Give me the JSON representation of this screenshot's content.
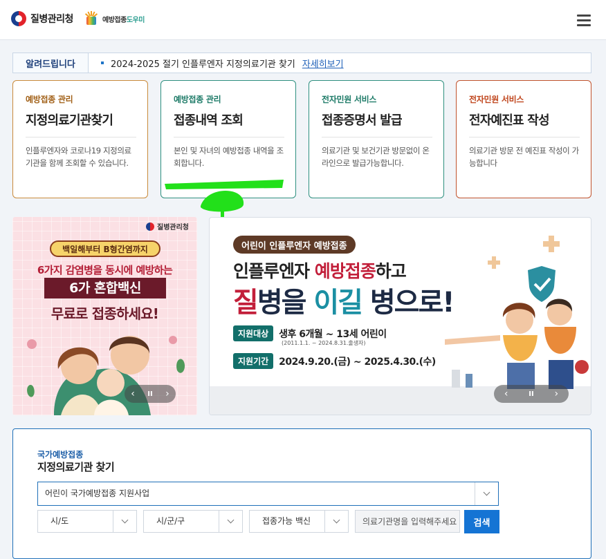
{
  "header": {
    "logo_text": "질병관리청",
    "helper_logo_prefix": "예방접종",
    "helper_logo_suffix": "도우미"
  },
  "notice": {
    "label": "알려드립니다",
    "text": "2024-2025 절기 인플루엔자 지정의료기관 찾기",
    "link": "자세히보기"
  },
  "cards": [
    {
      "category": "예방접종 관리",
      "title": "지정의료기관찾기",
      "desc": "인플루엔자와 코로나19 지정의료기관을 함께 조회할 수 있습니다."
    },
    {
      "category": "예방접종 관리",
      "title": "접종내역 조회",
      "desc": "본인 및 자녀의 예방접종 내역을 조회합니다."
    },
    {
      "category": "전자민원 서비스",
      "title": "접종증명서 발급",
      "desc": "의료기관 및 보건기관 방문없이 온라인으로 발급가능합니다."
    },
    {
      "category": "전자민원 서비스",
      "title": "전자예진표 작성",
      "desc": "의료기관 방문 전 예진표 작성이 가능합니다"
    }
  ],
  "banner_left": {
    "logo": "질병관리청",
    "pill": "백일해부터 B형간염까지",
    "line1": "6가지 감염병을 동시에 예방하는",
    "line2": "6가 혼합백신",
    "line3": "무료로 접종하세요!",
    "prev": "‹",
    "pause": "II",
    "next": "›"
  },
  "banner_right": {
    "pill": "어린이 인플루엔자 예방접종",
    "title1_a": "인플루엔자 ",
    "title1_hl": "예방접종",
    "title1_b": "하고",
    "title2_a": "질",
    "title2_b": "병을 ",
    "title2_c": "이길",
    "title2_d": " 병으로!",
    "target_tag": "지원대상",
    "target_val": "생후 6개월 ~ 13세 어린이",
    "target_sub": "(2011.1.1. ~ 2024.8.31.출생자)",
    "period_tag": "지원기간",
    "period_val": "2024.9.20.(금) ~ 2025.4.30.(수)",
    "prev": "‹",
    "pause": "II",
    "next": "›"
  },
  "search": {
    "category": "국가예방접종",
    "title": "지정의료기관 찾기",
    "program_value": "어린이 국가예방접종 지원사업",
    "sido": "시/도",
    "sigungu": "시/군/구",
    "vaccine": "접종가능 백신",
    "input_placeholder": "의료기관명을 입력해주세요",
    "button": "검색"
  },
  "colors": {
    "accent_blue": "#1574d4",
    "card_orange": "#c98a3a",
    "card_teal": "#2d8f7f",
    "card_red": "#c0522c",
    "annotation_green": "#22e01a"
  }
}
